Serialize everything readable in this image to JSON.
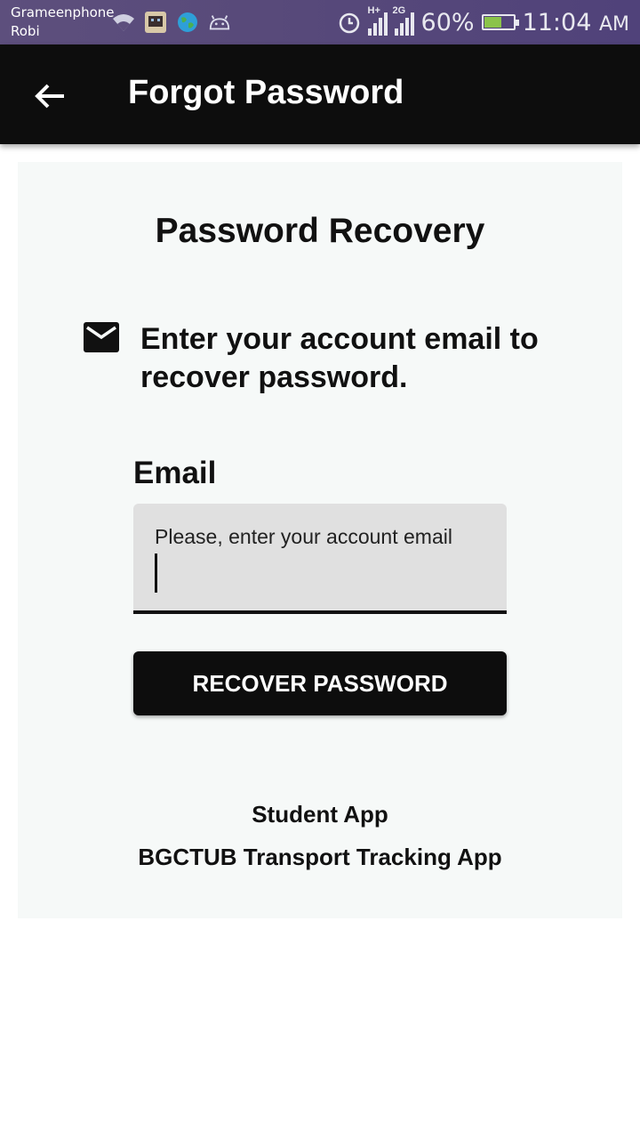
{
  "status_bar": {
    "carrier1": "Grameenphone",
    "carrier2": "Robi",
    "battery_percent": "60%",
    "battery_level": 0.6,
    "time": "11:04",
    "ampm": "AM",
    "network_label_1": "H+",
    "network_label_2": "2G",
    "icons": [
      "wifi-icon",
      "app-notification-icon",
      "globe-icon",
      "android-icon",
      "alarm-icon",
      "signal-icon",
      "battery-charging-icon"
    ]
  },
  "app_bar": {
    "title": "Forgot Password",
    "back_icon": "arrow-back-icon"
  },
  "card": {
    "title": "Password Recovery",
    "mail_icon": "mail-icon",
    "instruction": "Enter your account email to recover password.",
    "email_label": "Email",
    "email_placeholder": "Please, enter your account email",
    "email_value": "",
    "button_label": "RECOVER PASSWORD",
    "footer_line1": "Student App",
    "footer_line2": "BGCTUB Transport Tracking App"
  },
  "colors": {
    "status_bar": "#584a7a",
    "app_bar": "#0d0d0d",
    "card_bg": "#f6f9f8",
    "field_bg": "#e0e0e0",
    "button_bg": "#0d0d0d",
    "battery_fill": "#8bc34a"
  }
}
